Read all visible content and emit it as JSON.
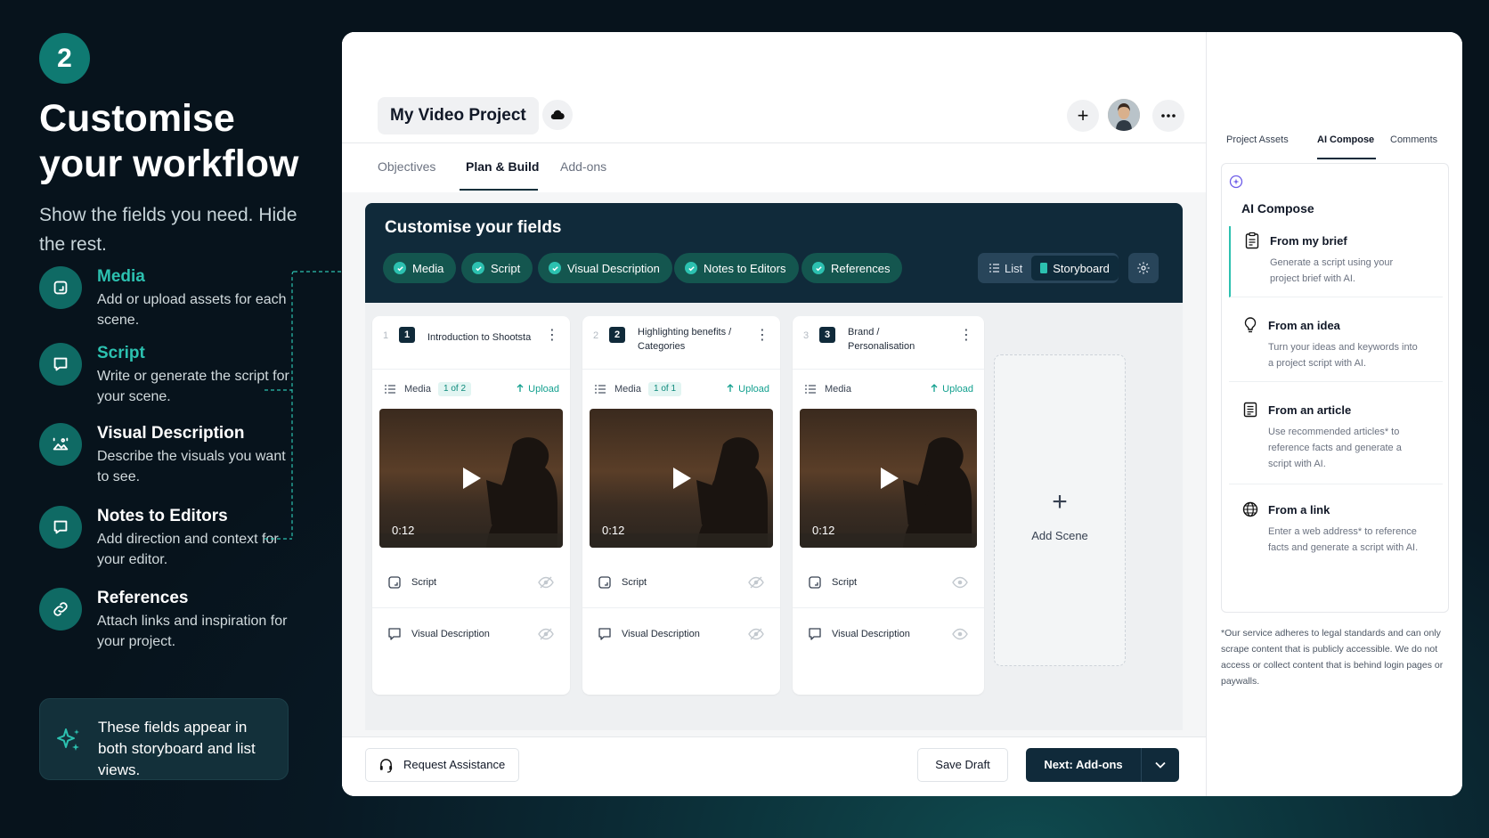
{
  "intro": {
    "step": "2",
    "headline": "Customise your workflow",
    "subtitle": "Show the fields you need. Hide the rest."
  },
  "features": [
    {
      "title": "Media",
      "desc": "Add or upload assets for each scene.",
      "icon": "media-icon"
    },
    {
      "title": "Script",
      "desc": "Write or generate the script for your scene.",
      "icon": "chat-bubble-icon"
    },
    {
      "title": "Visual Description",
      "desc": "Describe the visuals you want to see.",
      "icon": "image-icon"
    },
    {
      "title": "Notes to Editors",
      "desc": "Add direction and context for your editor.",
      "icon": "note-bubble-icon"
    },
    {
      "title": "References",
      "desc": "Attach links and inspiration for your project.",
      "icon": "link-icon"
    }
  ],
  "tip": "These fields appear in both storyboard and list views.",
  "header": {
    "project_title": "My Video Project"
  },
  "tabs": [
    "Objectives",
    "Plan & Build",
    "Add-ons"
  ],
  "fields_panel": {
    "title": "Customise your fields",
    "chips": [
      "Media",
      "Script",
      "Visual Description",
      "Notes to Editors",
      "References"
    ],
    "view_list": "List",
    "view_storyboard": "Storyboard"
  },
  "scenes": [
    {
      "index": "1",
      "number": "1",
      "title": "Introduction to Shootsta",
      "media_label": "Media",
      "media_count": "1 of 2",
      "upload": "Upload",
      "duration": "0:12",
      "script_label": "Script",
      "visual_label": "Visual Description"
    },
    {
      "index": "2",
      "number": "2",
      "title": "Highlighting benefits / Categories",
      "media_label": "Media",
      "media_count": "1 of 1",
      "upload": "Upload",
      "duration": "0:12",
      "script_label": "Script",
      "visual_label": "Visual Description"
    },
    {
      "index": "3",
      "number": "3",
      "title": "Brand / Personalisation",
      "media_label": "Media",
      "media_count": "",
      "upload": "Upload",
      "duration": "0:12",
      "script_label": "Script",
      "visual_label": "Visual Description"
    }
  ],
  "add_scene": "Add Scene",
  "footer": {
    "request": "Request Assistance",
    "save": "Save Draft",
    "next": "Next: Add-ons"
  },
  "side": {
    "tabs": [
      "Project Assets",
      "AI Compose",
      "Comments"
    ],
    "heading": "AI Compose",
    "options": [
      {
        "title": "From my brief",
        "desc": "Generate a script using your project brief with AI."
      },
      {
        "title": "From an idea",
        "desc": "Turn your ideas and keywords into a project script with AI."
      },
      {
        "title": "From an article",
        "desc": "Use recommended articles* to reference facts and generate a script with AI."
      },
      {
        "title": "From a link",
        "desc": "Enter a web address* to reference facts and generate a script with AI."
      }
    ],
    "disclaimer": "*Our service adheres to legal standards and can only scrape content that is publicly accessible. We do not access or collect content that is behind login pages or paywalls."
  },
  "colors": {
    "teal": "#2cc1b0",
    "navy": "#102a3a",
    "chip": "#14564f"
  }
}
